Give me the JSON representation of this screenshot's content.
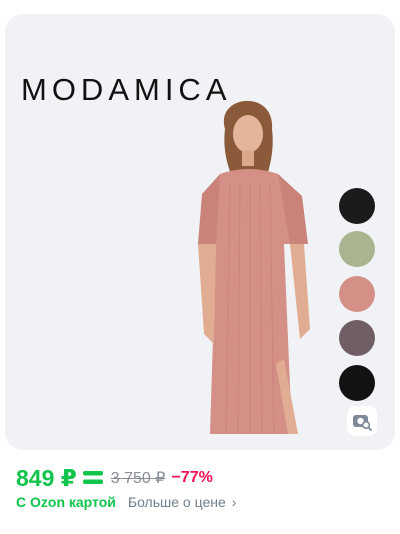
{
  "card": {
    "brand": "MODAMICA",
    "image_icon": "dress-photo",
    "swatches": [
      {
        "name": "black",
        "color": "#1b1b1b"
      },
      {
        "name": "sage",
        "color": "#a9b591"
      },
      {
        "name": "dusty-pink",
        "color": "#d48f86"
      },
      {
        "name": "taupe",
        "color": "#6f5e63"
      },
      {
        "name": "black",
        "color": "#121212"
      }
    ],
    "visual_search_icon": "camera-search-icon"
  },
  "pricing": {
    "price": "849 ₽",
    "ozon_badge_icon": "ozon-card-icon",
    "old_price": "3 750 ₽",
    "discount": "−77%",
    "ozon_card_label": "С Ozon картой",
    "more_price_label": "Больше о цене",
    "chevron": "›"
  },
  "colors": {
    "accent_green": "#10c44c",
    "discount_red": "#f91155"
  }
}
